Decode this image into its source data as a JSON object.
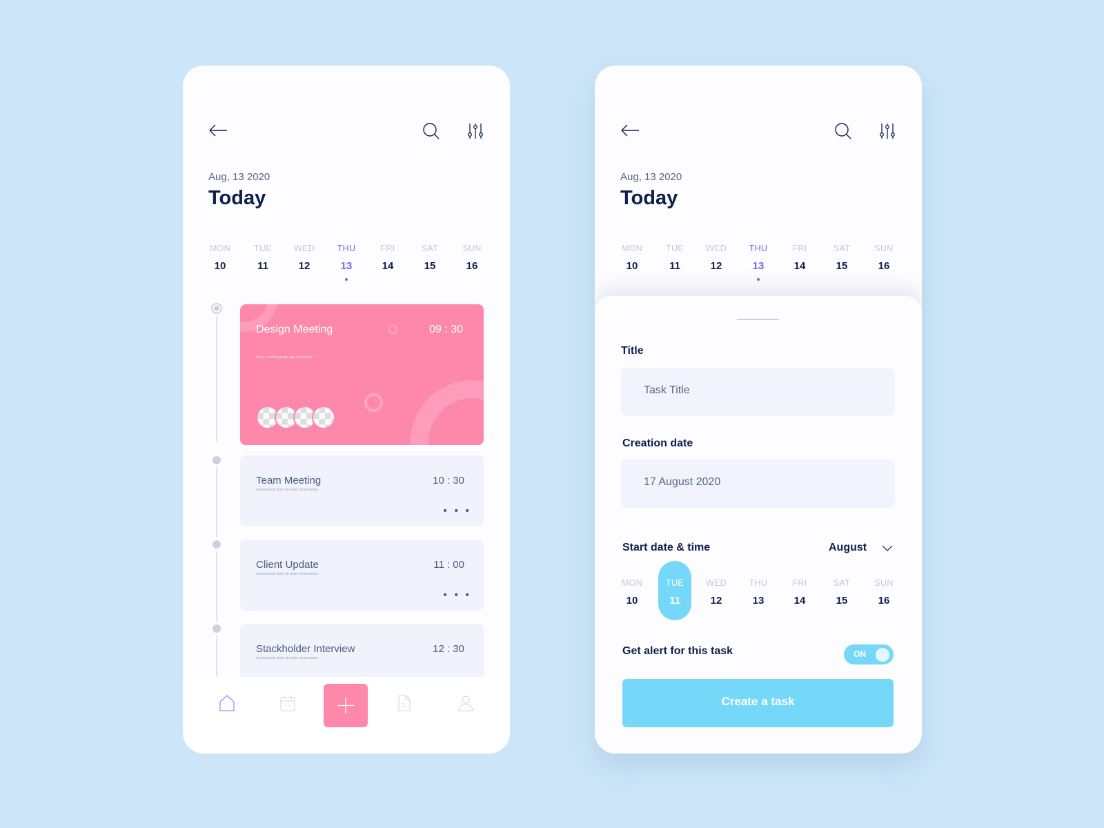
{
  "screens": [
    {
      "header": {
        "back": "arrow-left-icon",
        "search": "search-icon",
        "filter": "sliders-icon"
      },
      "date": "Aug, 13 2020",
      "title": "Today",
      "week": [
        {
          "n": "MON",
          "d": "10"
        },
        {
          "n": "TUE",
          "d": "11"
        },
        {
          "n": "WED",
          "d": "12"
        },
        {
          "n": "THU",
          "d": "13",
          "active": true
        },
        {
          "n": "FRI",
          "d": "14"
        },
        {
          "n": "SAT",
          "d": "15"
        },
        {
          "n": "SUN",
          "d": "16"
        }
      ],
      "tasks": [
        {
          "title": "Design Meeting",
          "time": "09 : 30",
          "desc": "Make a landing page app and mobile",
          "color": "#fe88ac"
        },
        {
          "title": "Team Meeting",
          "time": "10 : 30",
          "desc": "Lorem ipsum dolor sit amet consectetuer ."
        },
        {
          "title": "Client Update",
          "time": "11 : 00",
          "desc": "Lorem ipsum dolor sit amet consectetuer ."
        },
        {
          "title": "Stackholder Interview",
          "time": "12 : 30",
          "desc": "Lorem ipsum dolor sit amet consectetuer ."
        }
      ],
      "more": "• • •",
      "nav": [
        "home-icon",
        "calendar-icon",
        "plus-icon",
        "document-icon",
        "user-icon"
      ]
    },
    {
      "date": "Aug, 13 2020",
      "title": "Today",
      "week": [
        {
          "n": "MON",
          "d": "10"
        },
        {
          "n": "TUE",
          "d": "11"
        },
        {
          "n": "WED",
          "d": "12"
        },
        {
          "n": "THU",
          "d": "13",
          "active": true
        },
        {
          "n": "FRI",
          "d": "14"
        },
        {
          "n": "SAT",
          "d": "15"
        },
        {
          "n": "SUN",
          "d": "16"
        }
      ],
      "form": {
        "title_label": "Title",
        "title_placeholder": "Task Title",
        "creation_label": "Creation date",
        "creation_value": "17 August 2020",
        "start_label": "Start date & time",
        "month": "August",
        "week": [
          {
            "n": "MON",
            "d": "10"
          },
          {
            "n": "TUE",
            "d": "11",
            "selected": true
          },
          {
            "n": "WED",
            "d": "12"
          },
          {
            "n": "THU",
            "d": "13"
          },
          {
            "n": "FRI",
            "d": "14"
          },
          {
            "n": "SAT",
            "d": "15"
          },
          {
            "n": "SUN",
            "d": "16"
          }
        ],
        "alert_label": "Get alert for this task",
        "toggle": "ON",
        "toggle_on": true,
        "submit": "Create a task"
      }
    }
  ],
  "colors": {
    "background": "#cce5f8",
    "pink": "#fe88ac",
    "cyan": "#76d8f9",
    "navy": "#0f1f4b",
    "purple": "#7b61ff"
  }
}
